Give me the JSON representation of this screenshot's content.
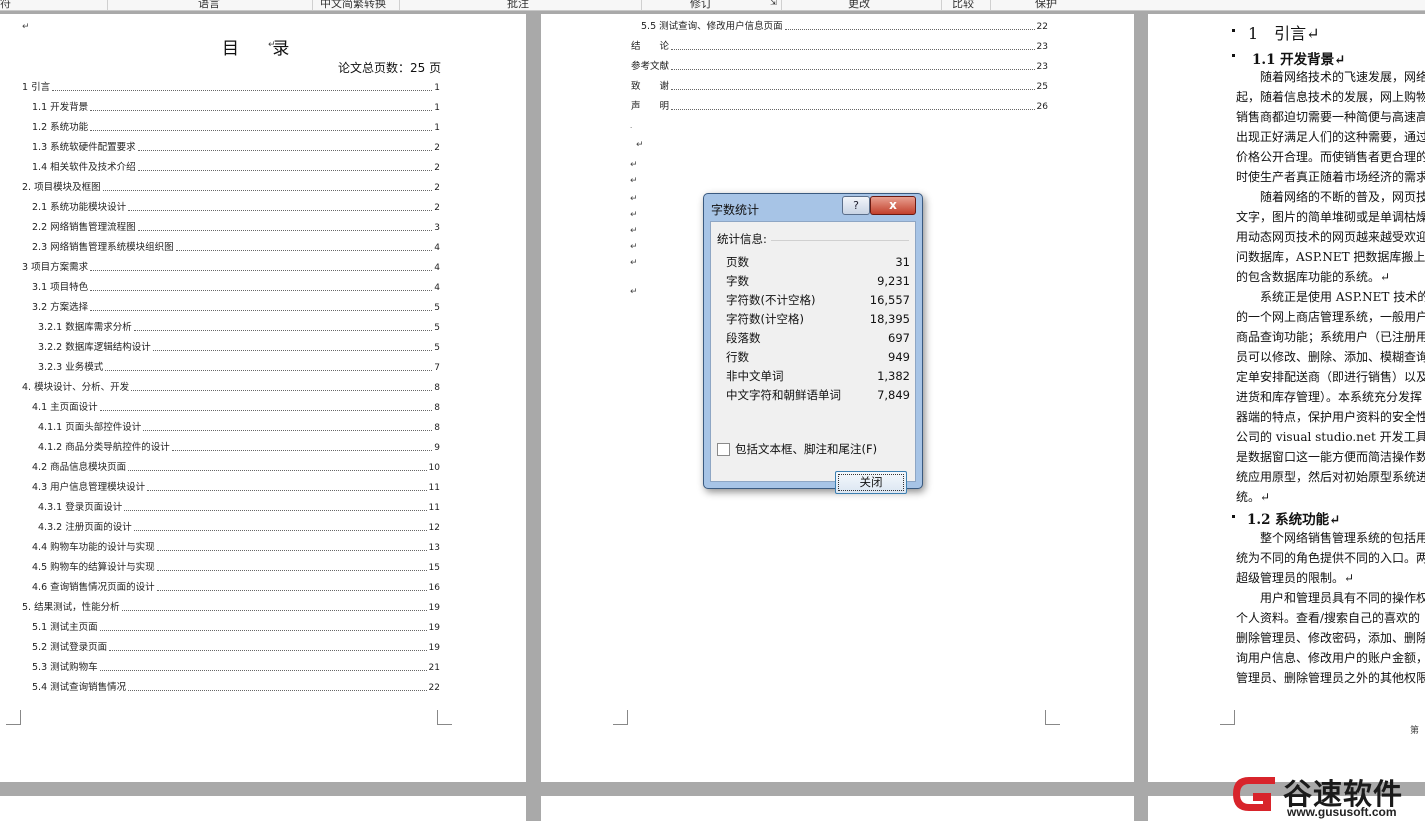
{
  "ribbon": {
    "labels": [
      "符",
      "语言",
      "中文简繁转换",
      "批注",
      "修订",
      "更改",
      "比较",
      "保护"
    ]
  },
  "page1": {
    "para_mark": "↵",
    "title": "目 录",
    "total_pages": "论文总页数：25 页",
    "toc": [
      {
        "text": "1 引言",
        "page": "1"
      },
      {
        "text": "1.1 开发背景",
        "page": "1"
      },
      {
        "text": "1.2 系统功能",
        "page": "1"
      },
      {
        "text": "1.3 系统软硬件配置要求",
        "page": "2"
      },
      {
        "text": "1.4 相关软件及技术介绍",
        "page": "2"
      },
      {
        "text": "2. 项目模块及框图",
        "page": "2"
      },
      {
        "text": "2.1 系统功能模块设计",
        "page": "2"
      },
      {
        "text": "2.2 网络销售管理流程图",
        "page": "3"
      },
      {
        "text": "2.3 网络销售管理系统模块组织图",
        "page": "4"
      },
      {
        "text": "3 项目方案需求",
        "page": "4"
      },
      {
        "text": "3.1 项目特色",
        "page": "4"
      },
      {
        "text": "3.2 方案选择",
        "page": "5"
      },
      {
        "text": "3.2.1 数据库需求分析",
        "page": "5"
      },
      {
        "text": "3.2.2 数据库逻辑结构设计",
        "page": "5"
      },
      {
        "text": "3.2.3 业务模式",
        "page": "7"
      },
      {
        "text": "4. 模块设计、分析、开发",
        "page": "8"
      },
      {
        "text": "4.1 主页面设计",
        "page": "8"
      },
      {
        "text": "4.1.1 页面头部控件设计",
        "page": "8"
      },
      {
        "text": "4.1.2 商品分类导航控件的设计",
        "page": "9"
      },
      {
        "text": "4.2 商品信息模块页面",
        "page": "10"
      },
      {
        "text": "4.3 用户信息管理模块设计",
        "page": "11"
      },
      {
        "text": "4.3.1 登录页面设计",
        "page": "11"
      },
      {
        "text": "4.3.2 注册页面的设计",
        "page": "12"
      },
      {
        "text": "4.4 购物车功能的设计与实现",
        "page": "13"
      },
      {
        "text": "4.5 购物车的结算设计与实现",
        "page": "15"
      },
      {
        "text": "4.6 查询销售情况页面的设计",
        "page": "16"
      },
      {
        "text": "5. 结果测试，性能分析",
        "page": "19"
      },
      {
        "text": "5.1 测试主页面",
        "page": "19"
      },
      {
        "text": "5.2 测试登录页面",
        "page": "19"
      },
      {
        "text": "5.3 测试购物车",
        "page": "21"
      },
      {
        "text": "5.4 测试查询销售情况",
        "page": "22"
      }
    ]
  },
  "page2": {
    "toc": [
      {
        "text": "5.5 测试查询、修改用户信息页面",
        "page": "22"
      },
      {
        "text": "结　　论",
        "page": "23"
      },
      {
        "text": "参考文献",
        "page": "23"
      },
      {
        "text": "致　　谢",
        "page": "25"
      },
      {
        "text": "声　　明",
        "page": "26"
      }
    ],
    "para_mark": "↵"
  },
  "page3": {
    "h1": "1　引言↵",
    "h2a": "1.1 开发背景↵",
    "lines_a": [
      "　　随着网络技术的飞速发展，网络",
      "起，随着信息技术的发展，网上购物",
      "销售商都迫切需要一种简便与高速高",
      "出现正好满足人们的这种需要，通过",
      "价格公开合理。而使销售者更合理的",
      "时使生产者真正随着市场经济的需求",
      "　　随着网络的不断的普及，网页技",
      "文字，图片的简单堆砌或是单调枯燥",
      "用动态网页技术的网页越来越受欢迎",
      "问数据库，ASP.NET 把数据库搬上了",
      "的包含数据库功能的系统。↵",
      "　　系统正是使用 ASP.NET 技术的动",
      "的一个网上商店管理系统，一般用户",
      "商品查询功能；系统用户（已注册用",
      "员可以修改、删除、添加、模糊查询",
      "定单安排配送商（即进行销售）以及向",
      "进货和库存管理）。本系统充分发挥",
      "器端的特点，保护用户资料的安全性",
      "公司的 visual studio.net 开发工具",
      "是数据窗口这一能方便而简洁操作数",
      "统应用原型，然后对初始原型系统进",
      "统。↵"
    ],
    "h2b": "1.2 系统功能↵",
    "lines_b": [
      "　　整个网络销售管理系统的包括用",
      "统为不同的角色提供不同的入口。两",
      "超级管理员的限制。↵",
      "　　用户和管理员具有不同的操作权",
      "个人资料。查看/搜索自己的喜欢的",
      "删除管理员、修改密码，添加、删除",
      "询用户信息、修改用户的账户金额，",
      "管理员、删除管理员之外的其他权限"
    ],
    "footer": "第"
  },
  "dialog": {
    "title": "字数统计",
    "help": "?",
    "close_x": "x",
    "stats_header": "统计信息:",
    "stats": [
      {
        "label": "页数",
        "value": "31"
      },
      {
        "label": "字数",
        "value": "9,231"
      },
      {
        "label": "字符数(不计空格)",
        "value": "16,557"
      },
      {
        "label": "字符数(计空格)",
        "value": "18,395"
      },
      {
        "label": "段落数",
        "value": "697"
      },
      {
        "label": "行数",
        "value": "949"
      },
      {
        "label": "非中文单词",
        "value": "1,382"
      },
      {
        "label": "中文字符和朝鲜语单词",
        "value": "7,849"
      }
    ],
    "checkbox_label": "包括文本框、脚注和尾注(F)",
    "checkbox_checked": false,
    "close_button": "关闭"
  },
  "watermark": {
    "name": "谷速软件",
    "url": "www.gususoft.com",
    "color": "#d8242b"
  }
}
